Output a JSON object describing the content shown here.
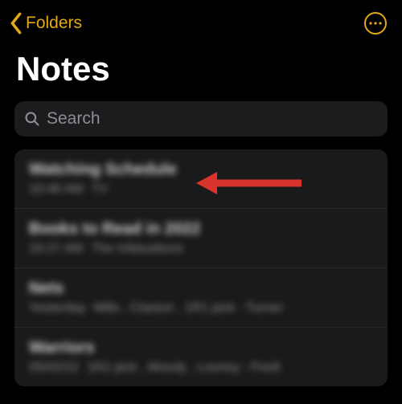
{
  "nav": {
    "back_label": "Folders",
    "more_name": "more"
  },
  "header": {
    "title": "Notes"
  },
  "search": {
    "placeholder": "Search"
  },
  "notes": [
    {
      "title": "Watching Schedule",
      "time": "10:46 AM",
      "preview": "TV"
    },
    {
      "title": "Books to Read in 2022",
      "time": "10:27 AM",
      "preview": "The Infatuations"
    },
    {
      "title": "Nets",
      "time": "Yesterday",
      "preview": "Mills , Claxton , 1R1 pick - Turner"
    },
    {
      "title": "Warriors",
      "time": "05/02/22",
      "preview": "1R2 pick , Moody , Looney - Poelt"
    }
  ],
  "colors": {
    "accent": "#e3a916",
    "annotation": "#d9342b"
  }
}
